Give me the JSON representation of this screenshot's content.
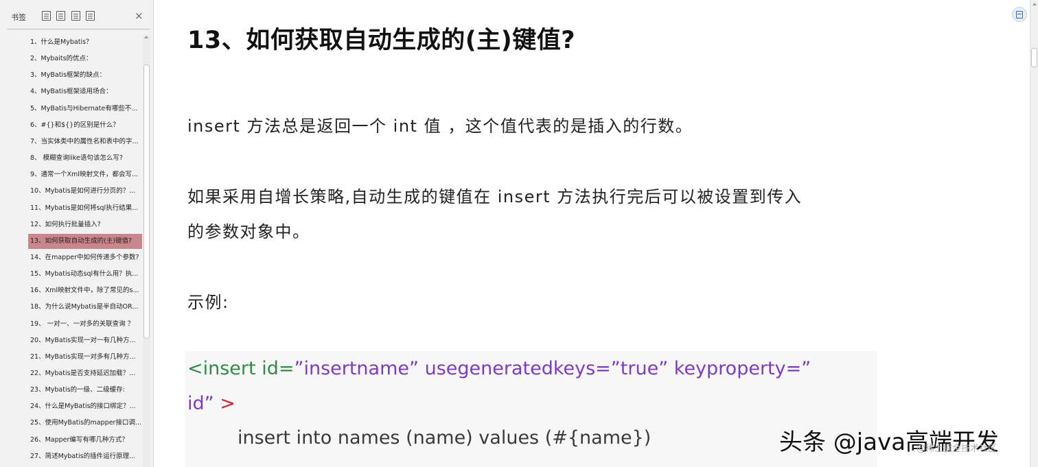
{
  "sidebar": {
    "title": "书签",
    "close_glyph": "×",
    "toolbar_icons": [
      "expand-all-icon",
      "collapse-all-icon",
      "add-bookmark-icon",
      "bookmark-options-icon"
    ],
    "items": [
      {
        "label": "1、什么是Mybatis？"
      },
      {
        "label": "2、Mybaits的优点："
      },
      {
        "label": "3、MyBatis框架的缺点："
      },
      {
        "label": "4、MyBatis框架适用场合："
      },
      {
        "label": "5、MyBatis与Hibernate有哪些不..."
      },
      {
        "label": "6、#{}和${}的区别是什么？"
      },
      {
        "label": "7、当实体类中的属性名和表中的字..."
      },
      {
        "label": "8、 模糊查询like语句该怎么写?"
      },
      {
        "label": "9、通常一个Xml映射文件，都会写..."
      },
      {
        "label": "10、Mybatis是如何进行分页的？..."
      },
      {
        "label": "11、Mybatis是如何将sql执行结果..."
      },
      {
        "label": "12、如何执行批量插入?"
      },
      {
        "label": "13、如何获取自动生成的(主)键值?",
        "active": true
      },
      {
        "label": "14、在mapper中如何传递多个参数?"
      },
      {
        "label": "15、Mybatis动态sql有什么用？执..."
      },
      {
        "label": "16、Xml映射文件中，除了常见的s..."
      },
      {
        "label": "18、为什么说Mybatis是半自动OR..."
      },
      {
        "label": "19、 一对一、一对多的关联查询 ？"
      },
      {
        "label": "20、MyBatis实现一对一有几种方..."
      },
      {
        "label": "21、MyBatis实现一对多有几种方..."
      },
      {
        "label": "22、Mybatis是否支持延迟加载？..."
      },
      {
        "label": "23、Mybatis的一级、二级缓存:"
      },
      {
        "label": "24、什么是MyBatis的接口绑定？..."
      },
      {
        "label": "25、使用MyBatis的mapper接口调..."
      },
      {
        "label": "26、Mapper编写有哪几种方式？"
      },
      {
        "label": "27、简述Mybatis的插件运行原理..."
      }
    ]
  },
  "document": {
    "heading": "13、如何获取自动生成的(主)键值?",
    "paragraph1": "insert  方法总是返回一个 int 值  ，这个值代表的是插入的行数。",
    "paragraph2_line1": "如果采用自增长策略,自动生成的键值在  insert  方法执行完后可以被设置到传入",
    "paragraph2_line2": "的参数对象中。",
    "example_label": "示例:",
    "code": {
      "line1_tag": "<insert",
      "line1_attr1": " id=",
      "line1_val1": "”insertname”",
      "line1_attr2": "    usegeneratedkeys=",
      "line1_val2": "”true”",
      "line1_attr3": "    keyproperty=",
      "line1_val3": "”",
      "line2_val": "id”",
      "line2_close": " >",
      "line3": "insert into names (name) values (#{name})"
    }
  },
  "watermark": {
    "main": "头条 @java高端开发",
    "sub": "@稀土掘金技术社区"
  },
  "colors": {
    "active_bookmark": "#c9878d",
    "code_tag": "#2f8b46",
    "code_value": "#7c3bc2",
    "code_close": "#d0222f",
    "code_background": "#f7f7f7"
  },
  "icons": {
    "floating_button": "document-tool-icon",
    "close": "close-icon"
  }
}
